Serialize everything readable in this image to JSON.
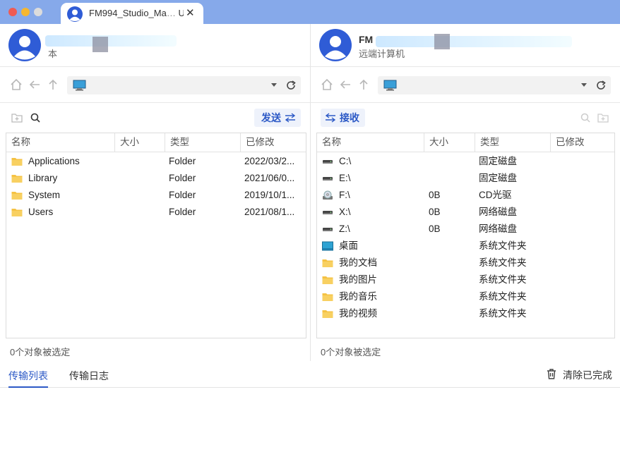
{
  "window": {
    "tab_title": "FM994_Studio_Ma",
    "tab_title_tail": "U",
    "close_glyph": "✕"
  },
  "left": {
    "account": {
      "name": "",
      "subtitle": "本"
    },
    "columns": [
      "名称",
      "大小",
      "类型",
      "已修改"
    ],
    "send_label": "发送",
    "rows": [
      {
        "name": "Applications",
        "size": "",
        "type": "Folder",
        "modified": "2022/03/2...",
        "icon": "folder-icon"
      },
      {
        "name": "Library",
        "size": "",
        "type": "Folder",
        "modified": "2021/06/0...",
        "icon": "folder-icon"
      },
      {
        "name": "System",
        "size": "",
        "type": "Folder",
        "modified": "2019/10/1...",
        "icon": "folder-icon"
      },
      {
        "name": "Users",
        "size": "",
        "type": "Folder",
        "modified": "2021/08/1...",
        "icon": "folder-icon"
      }
    ],
    "status": "0个对象被选定"
  },
  "right": {
    "account": {
      "name": "FM",
      "subtitle": "远端计算机"
    },
    "columns": [
      "名称",
      "大小",
      "类型",
      "已修改"
    ],
    "receive_label": "接收",
    "rows": [
      {
        "name": "C:\\",
        "size": "",
        "type": "固定磁盘",
        "modified": "",
        "icon": "drive-icon"
      },
      {
        "name": "E:\\",
        "size": "",
        "type": "固定磁盘",
        "modified": "",
        "icon": "drive-icon"
      },
      {
        "name": "F:\\",
        "size": "0B",
        "type": "CD光驱",
        "modified": "",
        "icon": "cd-drive-icon"
      },
      {
        "name": "X:\\",
        "size": "0B",
        "type": "网络磁盘",
        "modified": "",
        "icon": "drive-icon"
      },
      {
        "name": "Z:\\",
        "size": "0B",
        "type": "网络磁盘",
        "modified": "",
        "icon": "drive-icon"
      },
      {
        "name": "桌面",
        "size": "",
        "type": "系统文件夹",
        "modified": "",
        "icon": "desktop-icon"
      },
      {
        "name": "我的文档",
        "size": "",
        "type": "系统文件夹",
        "modified": "",
        "icon": "folder-icon"
      },
      {
        "name": "我的图片",
        "size": "",
        "type": "系统文件夹",
        "modified": "",
        "icon": "folder-icon"
      },
      {
        "name": "我的音乐",
        "size": "",
        "type": "系统文件夹",
        "modified": "",
        "icon": "folder-icon"
      },
      {
        "name": "我的视频",
        "size": "",
        "type": "系统文件夹",
        "modified": "",
        "icon": "folder-icon"
      }
    ],
    "status": "0个对象被选定"
  },
  "bottom": {
    "tabs": [
      "传输列表",
      "传输日志"
    ],
    "active_tab": "传输列表",
    "clear_label": "清除已完成"
  },
  "colors": {
    "accent": "#2c59c6",
    "titlebar": "#86a9ea",
    "folder": "#f5c243"
  }
}
